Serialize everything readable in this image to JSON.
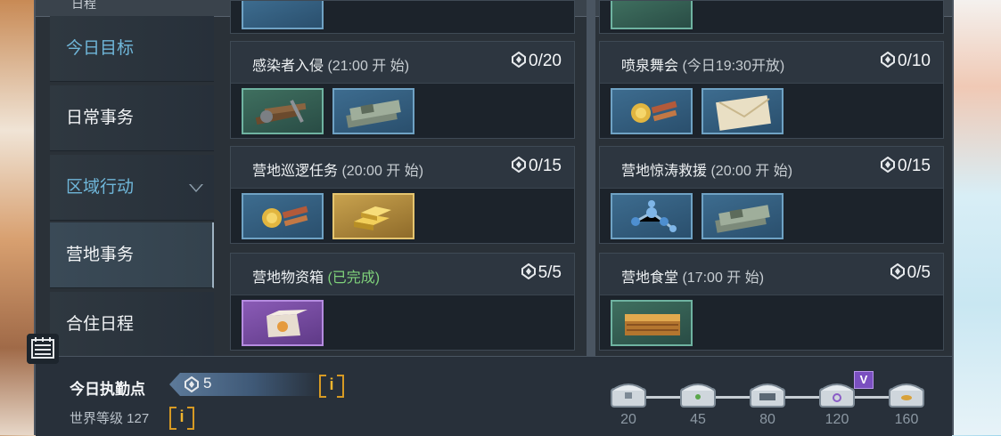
{
  "header": {
    "title": "日程"
  },
  "sidebar": {
    "items": [
      {
        "label": "今日目标",
        "state": "highlight"
      },
      {
        "label": "日常事务",
        "state": "normal"
      },
      {
        "label": "区域行动",
        "state": "highlight",
        "expandable": true
      },
      {
        "label": "营地事务",
        "state": "active"
      },
      {
        "label": "合住日程",
        "state": "normal"
      }
    ]
  },
  "cards": [
    {
      "name": "感染者入侵",
      "hint": "(21:00 开 始)",
      "count": "0/20",
      "rewards": [
        "materials-icon",
        "cash-icon"
      ]
    },
    {
      "name": "喷泉舞会",
      "hint": "(今日19:30开放)",
      "count": "0/10",
      "rewards": [
        "medal-icon",
        "invitation-icon"
      ]
    },
    {
      "name": "营地巡逻任务",
      "hint": "(20:00 开 始)",
      "count": "0/15",
      "rewards": [
        "medal-icon",
        "gold-bar-icon"
      ]
    },
    {
      "name": "营地惊涛救援",
      "hint": "(20:00 开 始)",
      "count": "0/15",
      "rewards": [
        "molecule-icon",
        "cash-icon"
      ]
    },
    {
      "name": "营地物资箱",
      "hint": "(已完成)",
      "count": "5/5",
      "rewards": [
        "supply-box-icon"
      ]
    },
    {
      "name": "营地食堂",
      "hint": "(17:00 开 始)",
      "count": "0/5",
      "rewards": [
        "food-icon"
      ]
    }
  ],
  "bottom": {
    "duty_label": "今日执勤点",
    "duty_value": "5",
    "info_label": "i",
    "world_label": "世界等级 127",
    "tiers": [
      "20",
      "45",
      "80",
      "120",
      "160"
    ],
    "vip_badge": "V"
  },
  "colors": {
    "accent": "#6fb6d9",
    "done": "#7fd27a",
    "info": "#f0b52e",
    "panel": "#2a3138"
  }
}
